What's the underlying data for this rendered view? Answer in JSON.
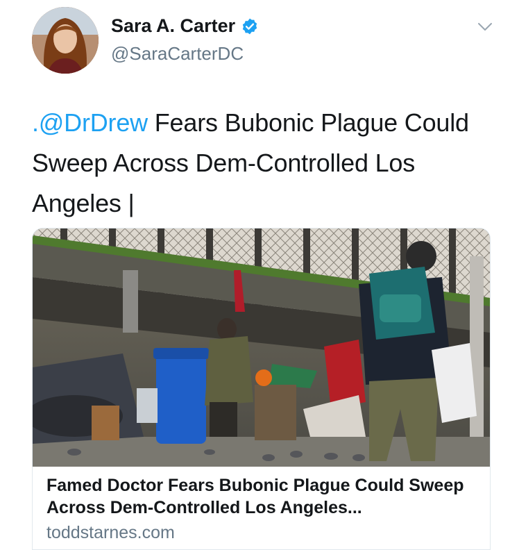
{
  "author": {
    "display_name": "Sara A. Carter",
    "handle": "@SaraCarterDC",
    "verified": true,
    "avatar_icon": "profile-photo"
  },
  "menu": {
    "icon": "chevron-down-icon"
  },
  "tweet": {
    "mention": ".@DrDrew",
    "text": " Fears Bubonic Plague Could Sweep Across Dem-Controlled Los Angeles |"
  },
  "card": {
    "image_icon": "photo-homeless-encampment",
    "title": "Famed Doctor Fears Bubonic Plague Could Sweep Across Dem-Controlled Los Angeles...",
    "domain": "toddstarnes.com"
  },
  "colors": {
    "link": "#1da1f2",
    "verified": "#1da1f2",
    "secondary_text": "#657786"
  }
}
